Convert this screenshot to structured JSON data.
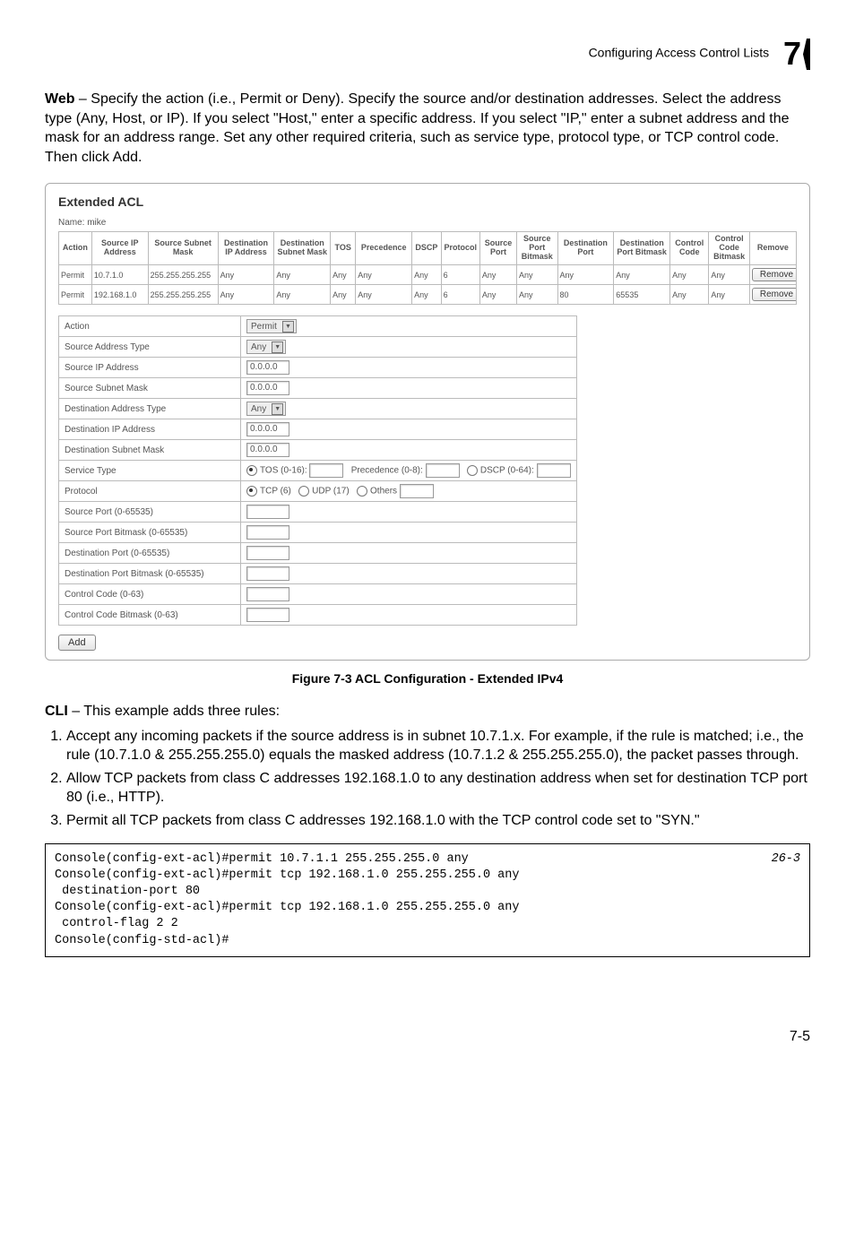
{
  "header": {
    "section": "Configuring Access Control Lists",
    "chapter": "7"
  },
  "intro": {
    "web_bold": "Web",
    "web_text": " – Specify the action (i.e., Permit or Deny). Specify the source and/or destination addresses. Select the address type (Any, Host, or IP). If you select \"Host,\" enter a specific address. If you select \"IP,\" enter a subnet address and the mask for an address range. Set any other required criteria, such as service type, protocol type, or TCP control code. Then click Add."
  },
  "acl": {
    "title": "Extended ACL",
    "name_label": "Name: mike",
    "columns": [
      "Action",
      "Source IP Address",
      "Source Subnet Mask",
      "Destination IP Address",
      "Destination Subnet Mask",
      "TOS",
      "Precedence",
      "DSCP",
      "Protocol",
      "Source Port",
      "Source Port Bitmask",
      "Destination Port",
      "Destination Port Bitmask",
      "Control Code",
      "Control Code Bitmask",
      "Remove"
    ],
    "rows": [
      [
        "Permit",
        "10.7.1.0",
        "255.255.255.255",
        "Any",
        "Any",
        "Any",
        "Any",
        "Any",
        "6",
        "Any",
        "Any",
        "Any",
        "Any",
        "Any",
        "Any",
        "Remove"
      ],
      [
        "Permit",
        "192.168.1.0",
        "255.255.255.255",
        "Any",
        "Any",
        "Any",
        "Any",
        "Any",
        "6",
        "Any",
        "Any",
        "80",
        "65535",
        "Any",
        "Any",
        "Remove"
      ]
    ],
    "form": {
      "action": {
        "label": "Action",
        "value": "Permit"
      },
      "src_addr_type": {
        "label": "Source Address Type",
        "value": "Any"
      },
      "src_ip": {
        "label": "Source IP Address",
        "value": "0.0.0.0"
      },
      "src_mask": {
        "label": "Source Subnet Mask",
        "value": "0.0.0.0"
      },
      "dst_addr_type": {
        "label": "Destination Address Type",
        "value": "Any"
      },
      "dst_ip": {
        "label": "Destination IP Address",
        "value": "0.0.0.0"
      },
      "dst_mask": {
        "label": "Destination Subnet Mask",
        "value": "0.0.0.0"
      },
      "svc_type": {
        "label": "Service Type",
        "tos": "TOS (0-16):",
        "prec": "Precedence (0-8):",
        "dscp": "DSCP (0-64):"
      },
      "protocol": {
        "label": "Protocol",
        "tcp": "TCP (6)",
        "udp": "UDP (17)",
        "others": "Others"
      },
      "src_port": {
        "label": "Source Port (0-65535)"
      },
      "src_port_bm": {
        "label": "Source Port Bitmask (0-65535)"
      },
      "dst_port": {
        "label": "Destination Port (0-65535)"
      },
      "dst_port_bm": {
        "label": "Destination Port Bitmask (0-65535)"
      },
      "ctrl_code": {
        "label": "Control Code (0-63)"
      },
      "ctrl_code_bm": {
        "label": "Control Code Bitmask (0-63)"
      }
    },
    "add_button": "Add"
  },
  "figure_caption": "Figure 7-3   ACL Configuration - Extended IPv4",
  "cli": {
    "cli_bold": "CLI",
    "cli_text": " – This example adds three rules:",
    "steps": [
      "Accept any incoming packets if the source address is in subnet 10.7.1.x. For example, if the rule is matched; i.e., the rule (10.7.1.0 & 255.255.255.0) equals the masked address (10.7.1.2 & 255.255.255.0), the packet passes through.",
      "Allow TCP packets from class C addresses 192.168.1.0 to any destination address when set for destination TCP port 80 (i.e., HTTP).",
      "Permit all TCP packets from class C addresses 192.168.1.0 with the TCP control code set to \"SYN.\""
    ]
  },
  "code": {
    "ref": "26-3",
    "text": "Console(config-ext-acl)#permit 10.7.1.1 255.255.255.0 any\nConsole(config-ext-acl)#permit tcp 192.168.1.0 255.255.255.0 any\n destination-port 80\nConsole(config-ext-acl)#permit tcp 192.168.1.0 255.255.255.0 any\n control-flag 2 2\nConsole(config-std-acl)#"
  },
  "page_num": "7-5"
}
